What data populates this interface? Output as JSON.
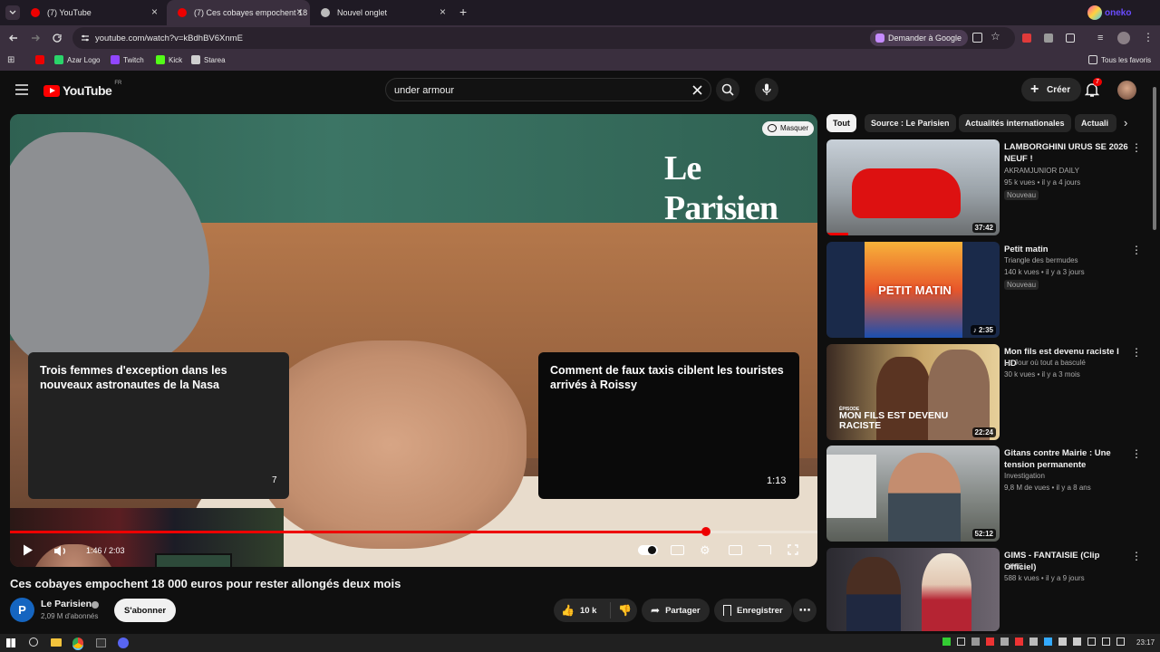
{
  "browser": {
    "tabs": [
      {
        "label": "(7) YouTube",
        "active": false
      },
      {
        "label": "(7) Ces cobayes empochent 18",
        "active": true
      },
      {
        "label": "Nouvel onglet",
        "active": false
      }
    ],
    "url": "youtube.com/watch?v=kBdhBV6XnmE",
    "ask_google": "Demander à Google",
    "bookmarks": [
      "Azar Logo",
      "Twitch",
      "Kick",
      "Starea"
    ],
    "all_favs": "Tous les favoris",
    "profile_badge": "oneko"
  },
  "youtube": {
    "logo": "YouTube",
    "region": "FR",
    "search_value": "under armour",
    "create": "Créer",
    "notif_count": "7"
  },
  "player": {
    "brand": "Le Parisien",
    "masquer": "Masquer",
    "endcard_left": "Trois femmes d'exception dans les nouveaux astronautes de la Nasa",
    "endcard_left_dur": "7",
    "endcard_right": "Comment de faux taxis ciblent les touristes arrivés à Roissy",
    "endcard_right_dur": "1:13",
    "time": "1:46 / 2:03",
    "progress": 0.862
  },
  "video": {
    "title": "Ces cobayes empochent 18 000 euros pour rester allongés deux mois",
    "channel": "Le Parisien",
    "subs": "2,09 M d'abonnés",
    "subscribe": "S'abonner",
    "likes": "10 k",
    "share": "Partager",
    "save": "Enregistrer"
  },
  "chips": [
    "Tout",
    "Source : Le Parisien",
    "Actualités internationales",
    "Actuali"
  ],
  "related": [
    {
      "title": "LAMBORGHINI URUS SE 2026 NEUF !",
      "channel": "AKRAMJUNIOR DAILY",
      "stats": "95 k vues • il y a 4 jours",
      "badge": "Nouveau",
      "duration": "37:42",
      "thumb_color": "#b8c0c8"
    },
    {
      "title": "Petit matin",
      "channel": "Triangle des bermudes",
      "stats": "140 k vues • il y a 3 jours",
      "badge": "Nouveau",
      "duration": "2:35",
      "thumb_color": "#f07a2c"
    },
    {
      "title": "Mon fils est devenu raciste I HD",
      "channel": "Le Jour où tout a basculé",
      "stats": "30 k vues • il y a 3 mois",
      "badge": "",
      "duration": "22:24",
      "thumb_color": "#c9a76a"
    },
    {
      "title": "Gitans contre Mairie : Une tension permanente",
      "channel": "Investigation",
      "stats": "9,8 M de vues • il y a 8 ans",
      "badge": "",
      "duration": "52:12",
      "thumb_color": "#8a8f86"
    },
    {
      "title": "GIMS - FANTAISIE (Clip Officiel)",
      "channel": "GIMS",
      "stats": "588 k vues • il y a 9 jours",
      "badge": "",
      "duration": "",
      "thumb_color": "#3c3a40"
    }
  ],
  "related_thumb_text": {
    "petit_matin": "PETIT MATIN",
    "episode": "ÉPISODE",
    "mon_fils": "MON FILS EST DEVENU RACISTE"
  },
  "taskbar": {
    "clock": "23:17"
  }
}
